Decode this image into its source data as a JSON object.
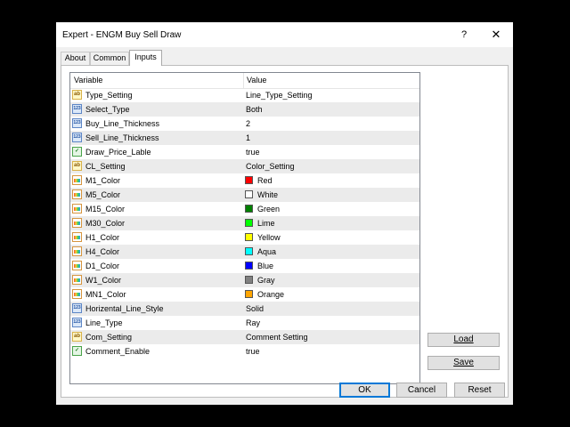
{
  "window": {
    "title": "Expert - ENGM Buy Sell Draw",
    "help_glyph": "?",
    "close_glyph": "✕"
  },
  "tabs": [
    {
      "label": "About"
    },
    {
      "label": "Common"
    },
    {
      "label": "Inputs"
    }
  ],
  "grid": {
    "headers": {
      "variable": "Variable",
      "value": "Value"
    },
    "rows": [
      {
        "icon": "text-type-icon",
        "name": "Type_Setting",
        "value": "Line_Type_Setting"
      },
      {
        "icon": "number-type-icon",
        "name": "Select_Type",
        "value": "Both"
      },
      {
        "icon": "number-type-icon",
        "name": "Buy_Line_Thickness",
        "value": "2"
      },
      {
        "icon": "number-type-icon",
        "name": "Sell_Line_Thickness",
        "value": "1"
      },
      {
        "icon": "boolean-type-icon",
        "name": "Draw_Price_Lable",
        "value": "true"
      },
      {
        "icon": "text-type-icon",
        "name": "CL_Setting",
        "value": "Color_Setting"
      },
      {
        "icon": "color-type-icon",
        "name": "M1_Color",
        "value": "Red",
        "swatch": "#ff0000"
      },
      {
        "icon": "color-type-icon",
        "name": "M5_Color",
        "value": "White",
        "swatch": "#ffffff"
      },
      {
        "icon": "color-type-icon",
        "name": "M15_Color",
        "value": "Green",
        "swatch": "#008000"
      },
      {
        "icon": "color-type-icon",
        "name": "M30_Color",
        "value": "Lime",
        "swatch": "#00ff00"
      },
      {
        "icon": "color-type-icon",
        "name": "H1_Color",
        "value": "Yellow",
        "swatch": "#ffff00"
      },
      {
        "icon": "color-type-icon",
        "name": "H4_Color",
        "value": "Aqua",
        "swatch": "#00ffff"
      },
      {
        "icon": "color-type-icon",
        "name": "D1_Color",
        "value": "Blue",
        "swatch": "#0000ff"
      },
      {
        "icon": "color-type-icon",
        "name": "W1_Color",
        "value": "Gray",
        "swatch": "#808080"
      },
      {
        "icon": "color-type-icon",
        "name": "MN1_Color",
        "value": "Orange",
        "swatch": "#ffa500"
      },
      {
        "icon": "number-type-icon",
        "name": "Horizental_Line_Style",
        "value": "Solid"
      },
      {
        "icon": "number-type-icon",
        "name": "Line_Type",
        "value": "Ray"
      },
      {
        "icon": "text-type-icon",
        "name": "Com_Setting",
        "value": "Comment Setting"
      },
      {
        "icon": "boolean-type-icon",
        "name": "Comment_Enable",
        "value": "true"
      }
    ]
  },
  "side_buttons": {
    "load": "Load",
    "save": "Save"
  },
  "footer_buttons": {
    "ok": "OK",
    "cancel": "Cancel",
    "reset": "Reset"
  },
  "colors": {
    "accent": "#0078d7",
    "alt_row": "#ebebeb"
  }
}
